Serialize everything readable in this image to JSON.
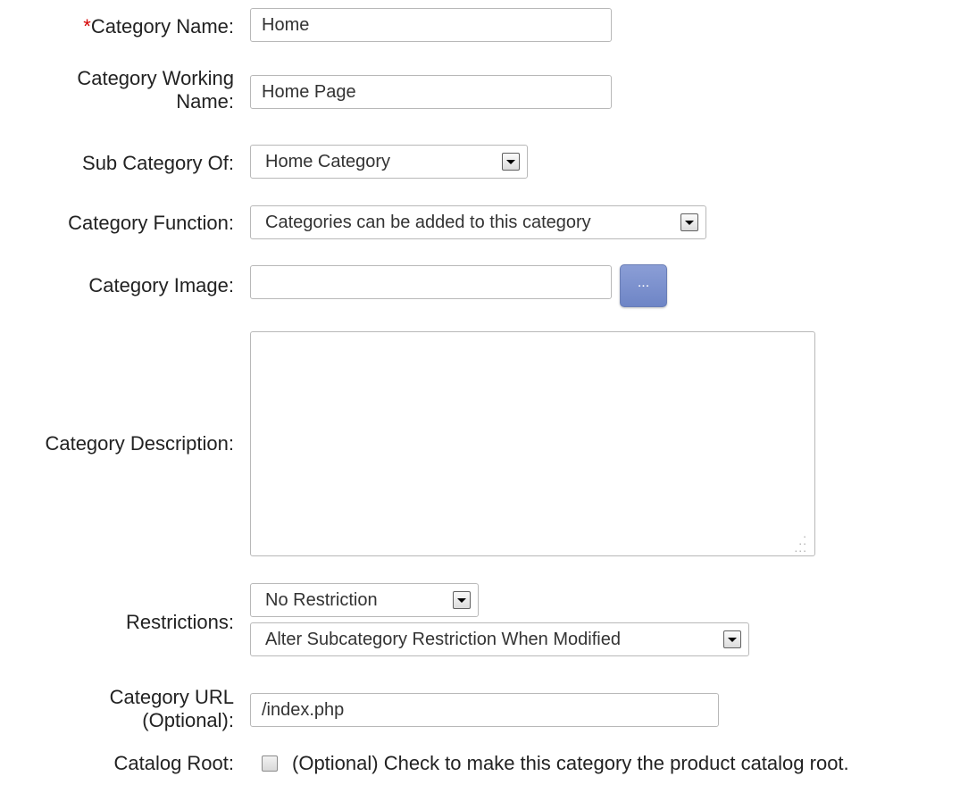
{
  "form": {
    "category_name": {
      "required_marker": "*",
      "label": "Category Name:",
      "value": "Home"
    },
    "working_name": {
      "label_line1": "Category Working",
      "label_line2": "Name:",
      "value": "Home Page"
    },
    "sub_category_of": {
      "label": "Sub Category Of:",
      "selected": "Home Category"
    },
    "category_function": {
      "label": "Category Function:",
      "selected": "Categories can be added to this category"
    },
    "category_image": {
      "label": "Category Image:",
      "value": "",
      "browse_label": "..."
    },
    "category_description": {
      "label": "Category Description:",
      "value": ""
    },
    "restrictions": {
      "label": "Restrictions:",
      "restriction_selected": "No Restriction",
      "subcategory_selected": "Alter Subcategory Restriction When Modified"
    },
    "category_url": {
      "label_line1": "Category URL",
      "label_line2": "(Optional):",
      "value": "/index.php"
    },
    "catalog_root": {
      "label": "Catalog Root:",
      "checked": false,
      "description": "(Optional) Check to make this category the product catalog root."
    }
  },
  "icons": {
    "dropdown": "chevron-down-icon",
    "resize": "resize-grip-icon"
  }
}
